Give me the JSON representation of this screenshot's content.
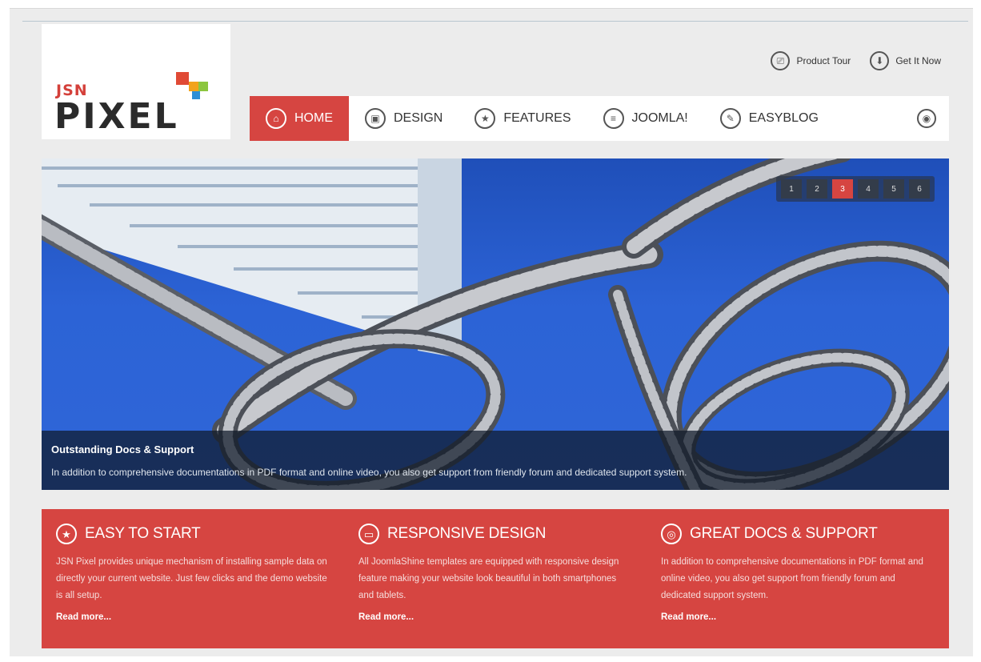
{
  "brand": {
    "jsn": "JSN",
    "pixel": "PIXEL"
  },
  "top_links": [
    {
      "label": "Product Tour",
      "icon": "product-tour-icon",
      "glyph": "⎚"
    },
    {
      "label": "Get It Now",
      "icon": "download-icon",
      "glyph": "⬇"
    }
  ],
  "nav": {
    "items": [
      {
        "label": "HOME",
        "icon": "home-icon",
        "glyph": "⌂",
        "active": true
      },
      {
        "label": "DESIGN",
        "icon": "design-icon",
        "glyph": "▣"
      },
      {
        "label": "FEATURES",
        "icon": "star-icon",
        "glyph": "★"
      },
      {
        "label": "JOOMLA!",
        "icon": "list-icon",
        "glyph": "≡"
      },
      {
        "label": "EASYBLOG",
        "icon": "edit-icon",
        "glyph": "✎"
      }
    ],
    "settings_icon": "settings-icon"
  },
  "slider": {
    "pages": [
      "1",
      "2",
      "3",
      "4",
      "5",
      "6"
    ],
    "active_page": "3",
    "caption_title": "Outstanding Docs & Support",
    "caption_text": "In addition to comprehensive documentations in PDF format and online video, you also get support from friendly forum and dedicated support system."
  },
  "features": [
    {
      "title": "EASY TO START",
      "icon": "star-icon",
      "glyph": "★",
      "text": "JSN Pixel provides unique mechanism of installing sample data on directly your current website. Just few clicks and the demo website is all setup.",
      "more": "Read more..."
    },
    {
      "title": "RESPONSIVE DESIGN",
      "icon": "monitor-icon",
      "glyph": "▭",
      "text": "All JoomlaShine templates are equipped with responsive design feature making your website look beautiful in both smartphones and tablets.",
      "more": "Read more..."
    },
    {
      "title": "GREAT DOCS & SUPPORT",
      "icon": "lifebuoy-icon",
      "glyph": "◎",
      "text": "In addition to comprehensive documentations in PDF format and online video, you also get support from friendly forum and dedicated support system.",
      "more": "Read more..."
    }
  ],
  "colors": {
    "accent": "#d64541",
    "sky": "#2c63d6"
  }
}
